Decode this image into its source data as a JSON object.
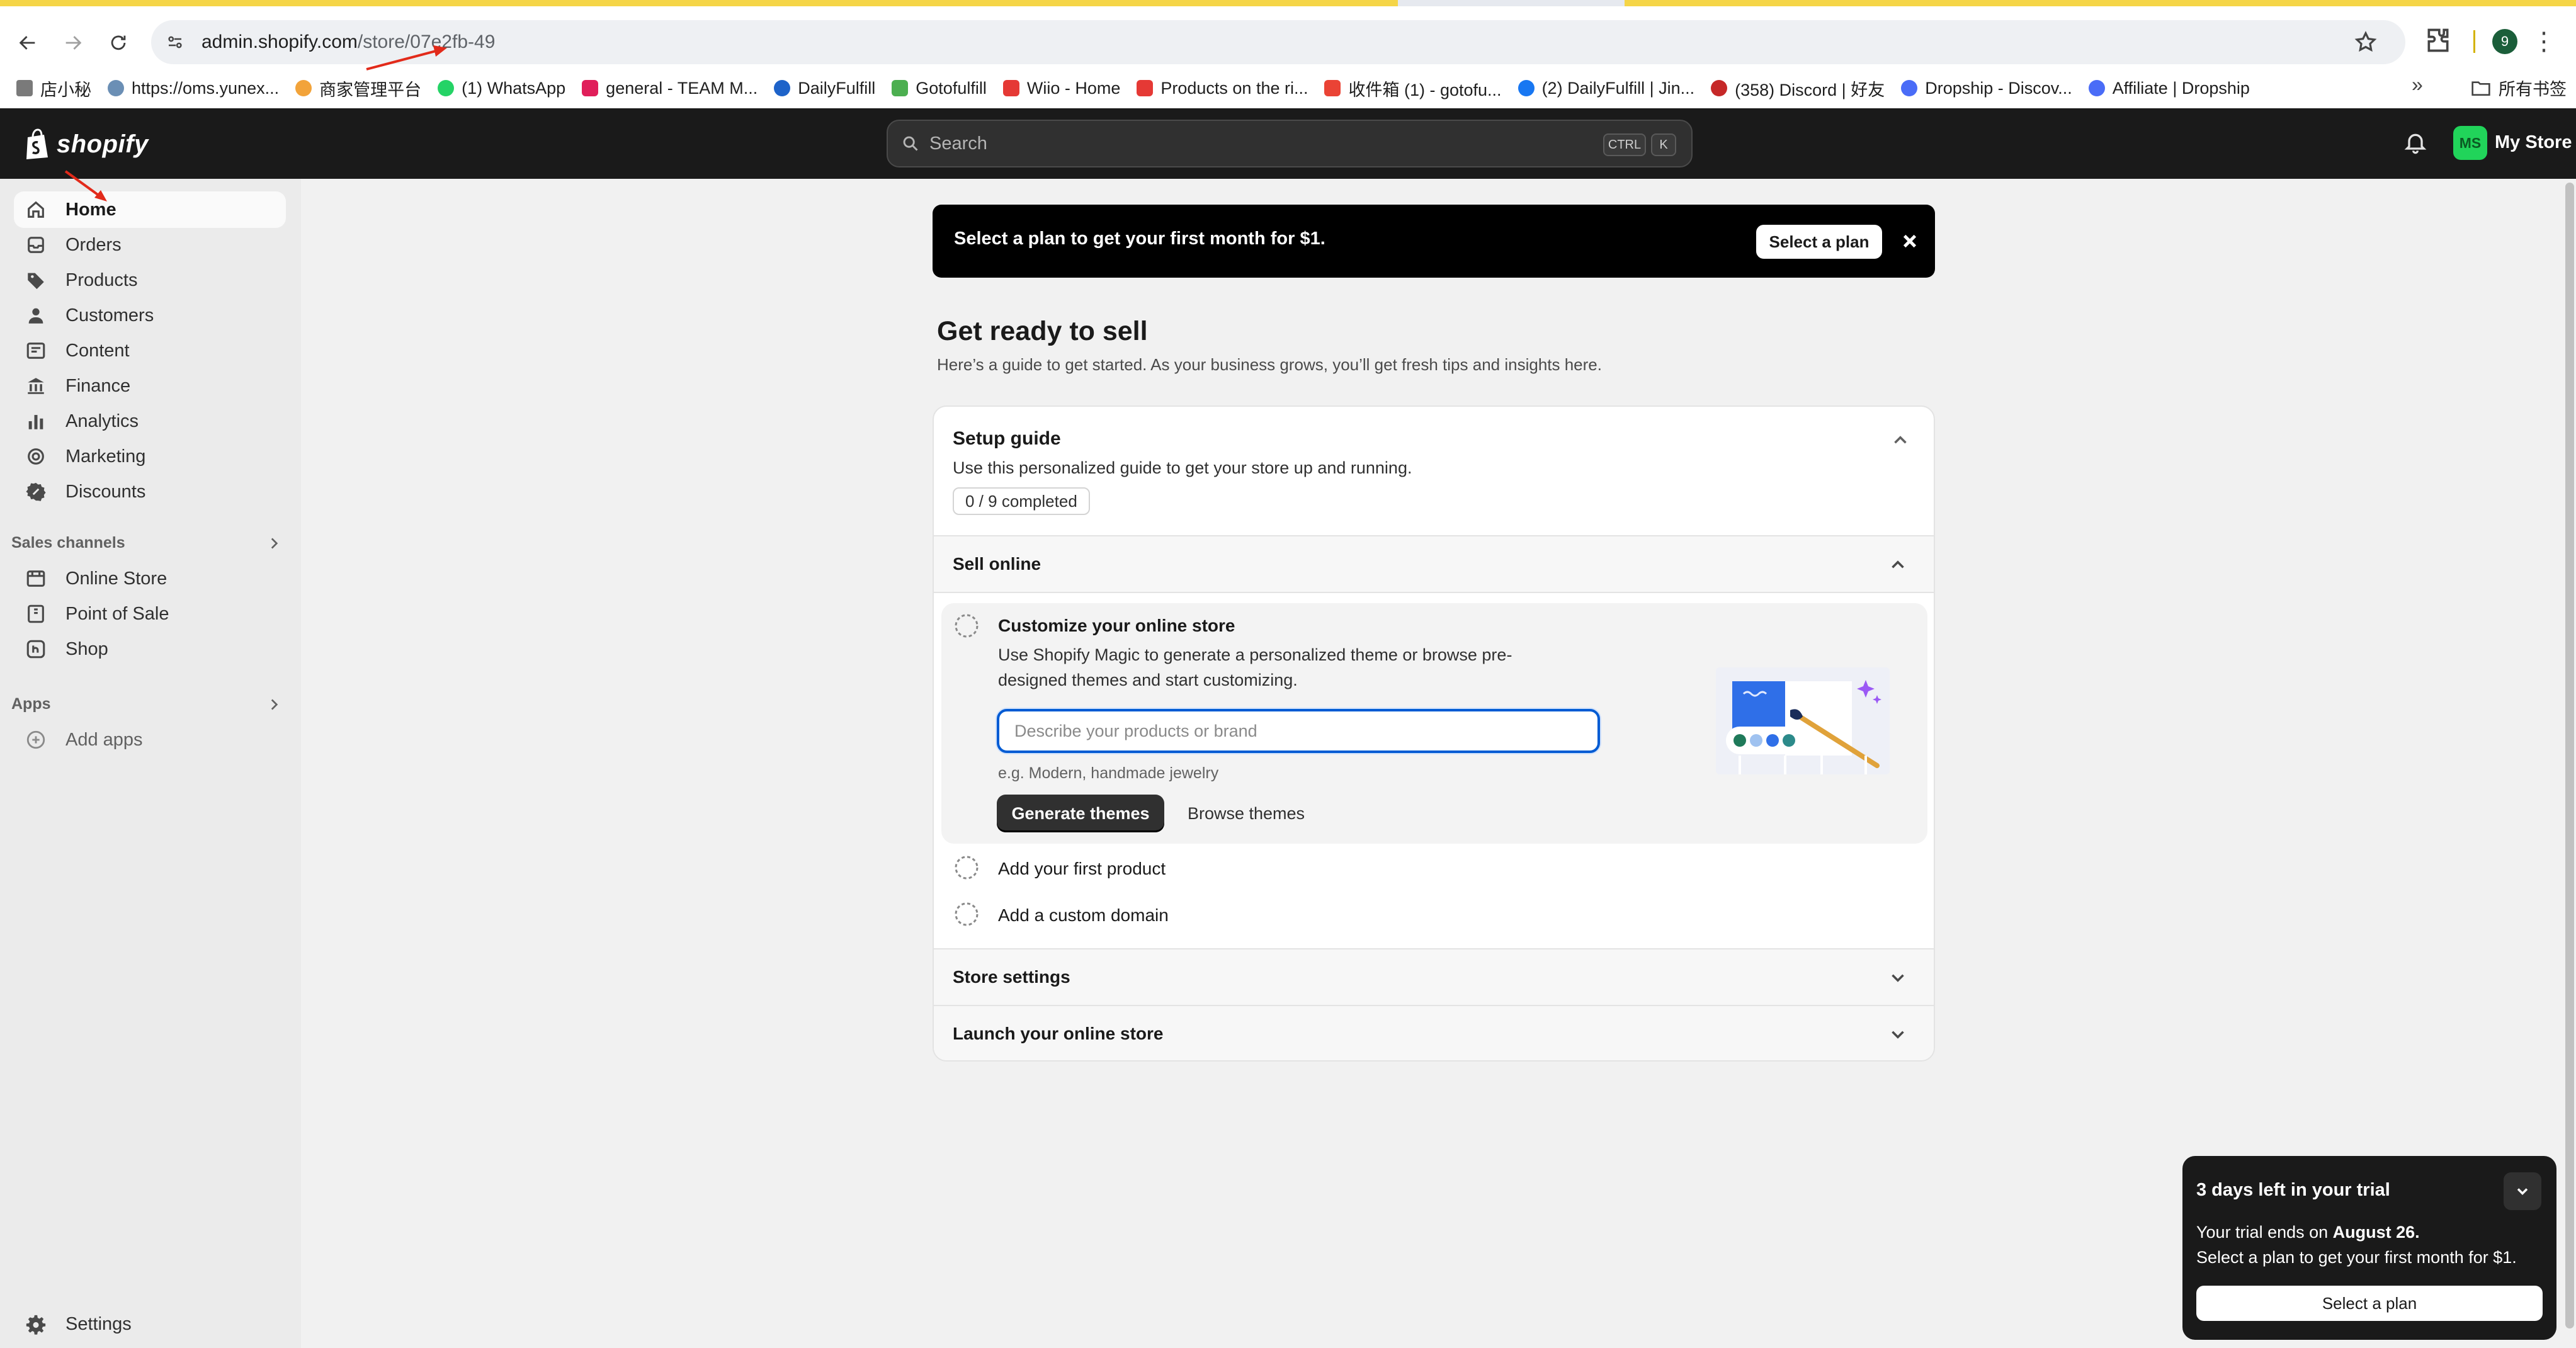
{
  "browser": {
    "url_host": "admin.shopify.com",
    "url_path": "/store/07e2fb-49",
    "profile_initial": "9",
    "bookmarks": [
      {
        "label": "店小秘",
        "color": "#7a7a7a"
      },
      {
        "label": "https://oms.yunex...",
        "color": "#6b8fb5"
      },
      {
        "label": "商家管理平台",
        "color": "#f2a33a"
      },
      {
        "label": "(1) WhatsApp",
        "color": "#25d366"
      },
      {
        "label": "general - TEAM M...",
        "color": "#e01e5a"
      },
      {
        "label": "DailyFulfill",
        "color": "#1e63c9"
      },
      {
        "label": "Gotofulfill",
        "color": "#4caf50"
      },
      {
        "label": "Wiio - Home",
        "color": "#e53935"
      },
      {
        "label": "Products on the ri...",
        "color": "#e53935"
      },
      {
        "label": "收件箱 (1) - gotofu...",
        "color": "#ea4335"
      },
      {
        "label": "(2) DailyFulfill | Jin...",
        "color": "#1877f2"
      },
      {
        "label": "(358) Discord | 好友",
        "color": "#c62828"
      },
      {
        "label": "Dropship - Discov...",
        "color": "#4a6cf7"
      },
      {
        "label": "Affiliate | Dropship",
        "color": "#4a6cf7"
      }
    ],
    "bookmarks_folder": "所有书签",
    "more_glyph": "»"
  },
  "topbar": {
    "brand": "shopify",
    "search_placeholder": "Search",
    "shortcut_ctrl": "CTRL",
    "shortcut_key": "K",
    "avatar_initials": "MS",
    "store_name": "My Store"
  },
  "sidebar": {
    "items": [
      {
        "label": "Home",
        "icon": "home-icon"
      },
      {
        "label": "Orders",
        "icon": "inbox-icon"
      },
      {
        "label": "Products",
        "icon": "tag-icon"
      },
      {
        "label": "Customers",
        "icon": "person-icon"
      },
      {
        "label": "Content",
        "icon": "content-icon"
      },
      {
        "label": "Finance",
        "icon": "bank-icon"
      },
      {
        "label": "Analytics",
        "icon": "bar-chart-icon"
      },
      {
        "label": "Marketing",
        "icon": "target-icon"
      },
      {
        "label": "Discounts",
        "icon": "discount-icon"
      }
    ],
    "sales_channels_title": "Sales channels",
    "sales_channels": [
      {
        "label": "Online Store",
        "icon": "store-icon"
      },
      {
        "label": "Point of Sale",
        "icon": "pos-icon"
      },
      {
        "label": "Shop",
        "icon": "shop-icon"
      }
    ],
    "apps_title": "Apps",
    "add_apps": "Add apps",
    "settings": "Settings"
  },
  "banner": {
    "text": "Select a plan to get your first month for $1.",
    "button": "Select a plan"
  },
  "page": {
    "title": "Get ready to sell",
    "subtitle": "Here’s a guide to get started. As your business grows, you’ll get fresh tips and insights here."
  },
  "setup_guide": {
    "title": "Setup guide",
    "description": "Use this personalized guide to get your store up and running.",
    "progress": "0 / 9 completed",
    "sections": {
      "sell_online": "Sell online",
      "store_settings": "Store settings",
      "launch": "Launch your online store"
    },
    "active_task": {
      "title": "Customize your online store",
      "description": "Use Shopify Magic to generate a personalized theme or browse pre-designed themes and start customizing.",
      "input_placeholder": "Describe your products or brand",
      "hint": "e.g. Modern, handmade jewelry",
      "primary_button": "Generate themes",
      "secondary_button": "Browse themes"
    },
    "tasks": [
      "Add your first product",
      "Add a custom domain"
    ]
  },
  "trial": {
    "title": "3 days left in your trial",
    "line1_prefix": "Your trial ends on ",
    "line1_date": "August 26.",
    "line2": "Select a plan to get your first month for $1.",
    "button": "Select a plan"
  }
}
